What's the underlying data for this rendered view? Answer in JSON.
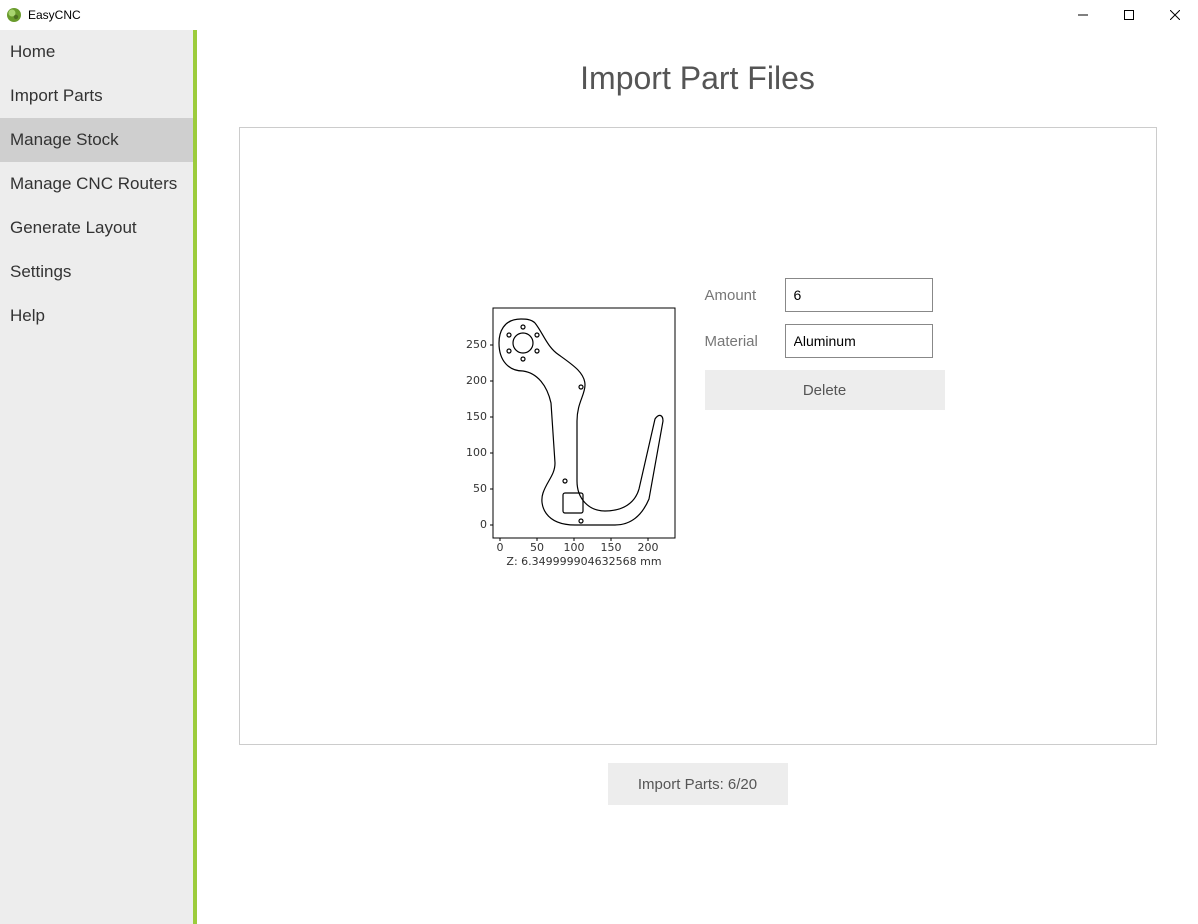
{
  "window": {
    "title": "EasyCNC"
  },
  "sidebar": {
    "items": [
      {
        "label": "Home"
      },
      {
        "label": "Import Parts"
      },
      {
        "label": "Manage Stock"
      },
      {
        "label": "Manage CNC Routers"
      },
      {
        "label": "Generate Layout"
      },
      {
        "label": "Settings"
      },
      {
        "label": "Help"
      }
    ],
    "selected_index": 2
  },
  "page": {
    "title": "Import Part Files",
    "form": {
      "amount_label": "Amount",
      "amount_value": "6",
      "material_label": "Material",
      "material_value": "Aluminum",
      "delete_label": "Delete"
    },
    "preview": {
      "x_ticks": [
        "0",
        "50",
        "100",
        "150",
        "200"
      ],
      "y_ticks": [
        "0",
        "50",
        "100",
        "150",
        "200",
        "250"
      ],
      "z_label": "Z: 6.349999904632568 mm"
    },
    "import_button_label": "Import Parts: 6/20"
  }
}
